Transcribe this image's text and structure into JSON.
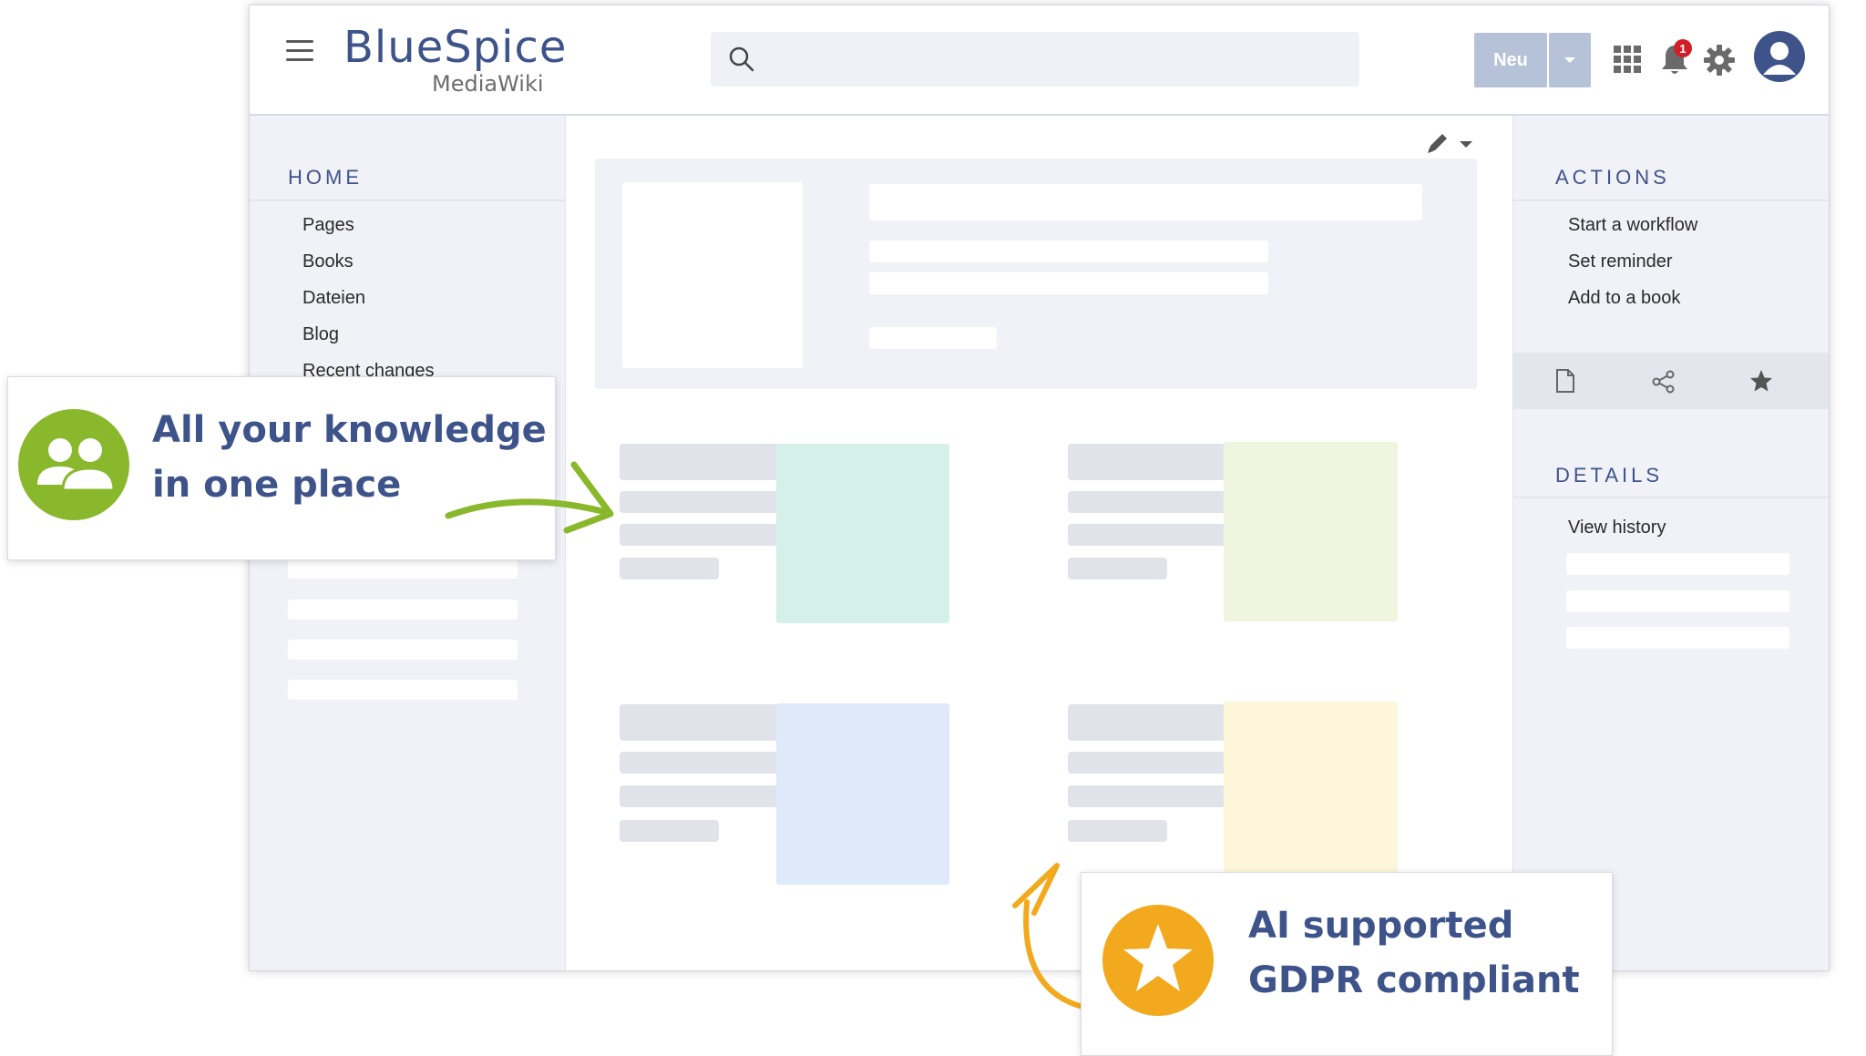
{
  "header": {
    "logo_main": "BlueSpice",
    "logo_sub": "MediaWiki",
    "search_placeholder": "",
    "new_button": "Neu",
    "notification_count": "1"
  },
  "left_sidebar": {
    "title": "HOME",
    "items": [
      "Pages",
      "Books",
      "Dateien",
      "Blog",
      "Recent changes"
    ]
  },
  "right_sidebar": {
    "actions_title": "ACTIONS",
    "actions": [
      "Start a workflow",
      "Set reminder",
      "Add to a book"
    ],
    "details_title": "DETAILS",
    "details": [
      "View history"
    ],
    "icons": [
      "page-icon",
      "share-icon",
      "star-icon"
    ]
  },
  "callouts": {
    "knowledge": {
      "line1": "All your knowledge",
      "line2": "in one place",
      "icon": "users-icon",
      "color": "#8ab82c"
    },
    "ai": {
      "line1": "AI supported",
      "line2": "GDPR compliant",
      "icon": "star-icon",
      "color": "#f2a91d"
    }
  },
  "colors": {
    "brand": "#3e5389",
    "button": "#b6c2d8",
    "badge": "#d11f2a",
    "card_teal": "#d5efe9",
    "card_lime": "#eff5df",
    "card_blue": "#dee9f9",
    "card_yellow": "#fdf6da"
  }
}
